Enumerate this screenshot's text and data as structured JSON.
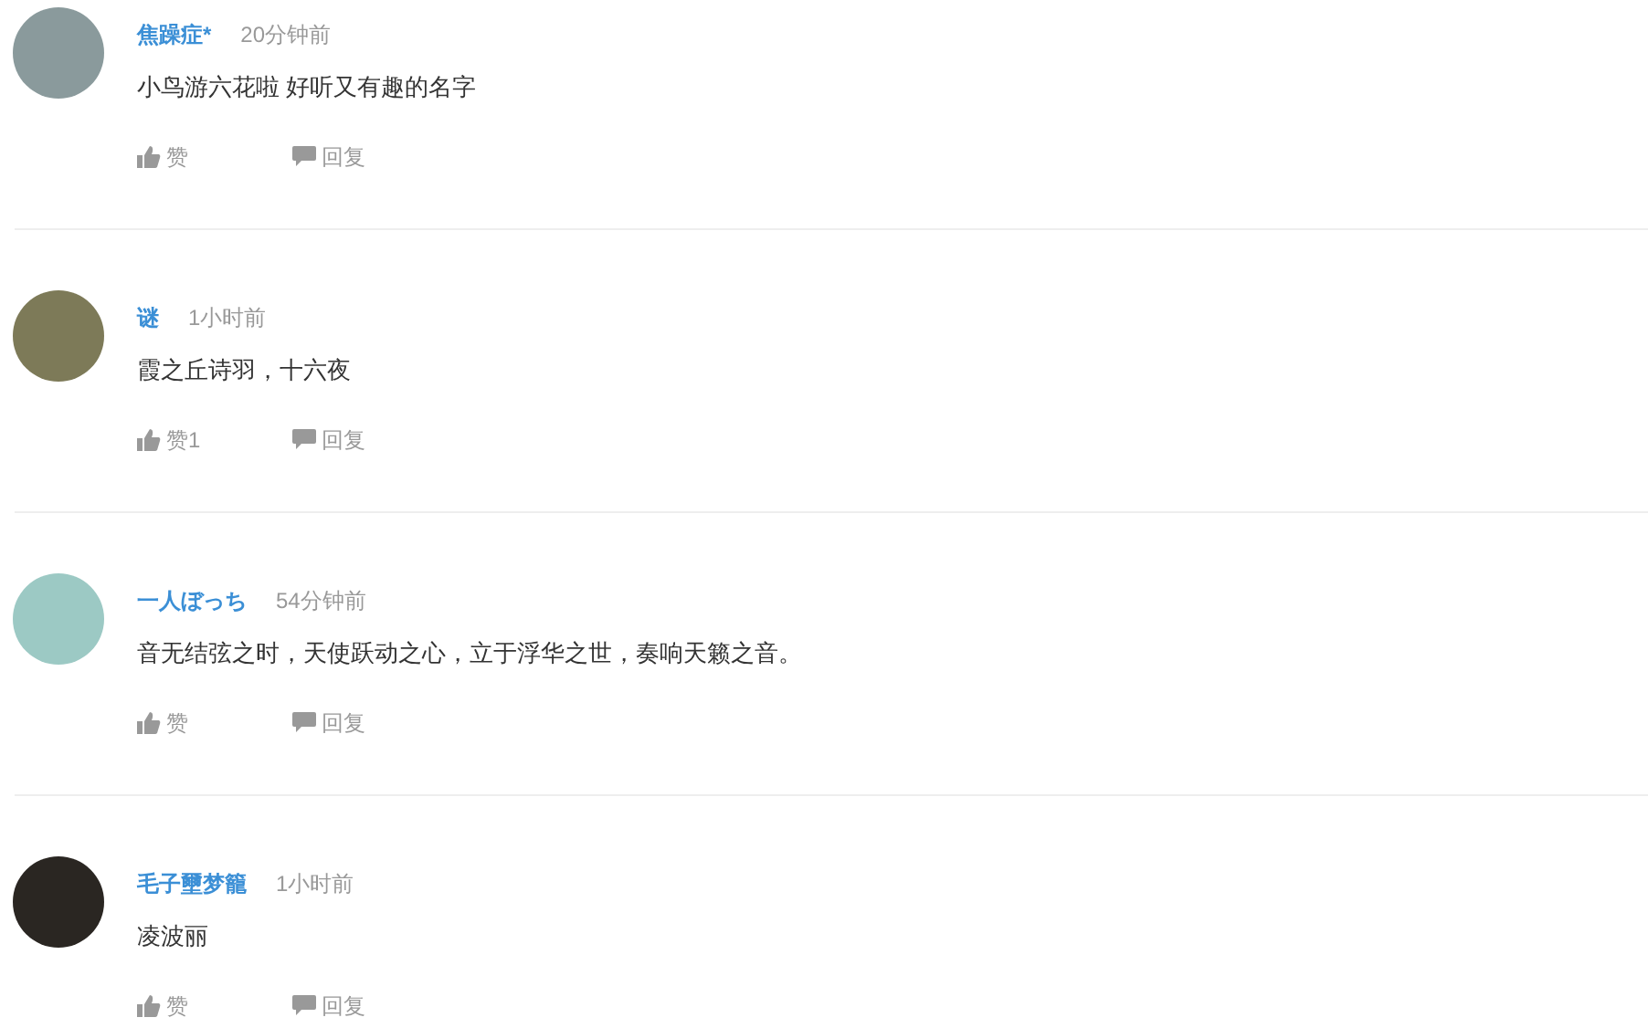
{
  "comments": [
    {
      "username": "焦躁症*",
      "time": "20分钟前",
      "text": "小鸟游六花啦 好听又有趣的名字",
      "like": "赞",
      "reply": "回复"
    },
    {
      "username": "谜",
      "time": "1小时前",
      "text": "霞之丘诗羽，十六夜",
      "like": "赞1",
      "reply": "回复"
    },
    {
      "username": "一人ぼっち",
      "time": "54分钟前",
      "text": "音无结弦之时，天使跃动之心，立于浮华之世，奏响天籁之音。",
      "like": "赞",
      "reply": "回复"
    },
    {
      "username": "毛子壐梦籠",
      "time": "1小时前",
      "text": "凌波丽",
      "like": "赞",
      "reply": "回复"
    }
  ]
}
